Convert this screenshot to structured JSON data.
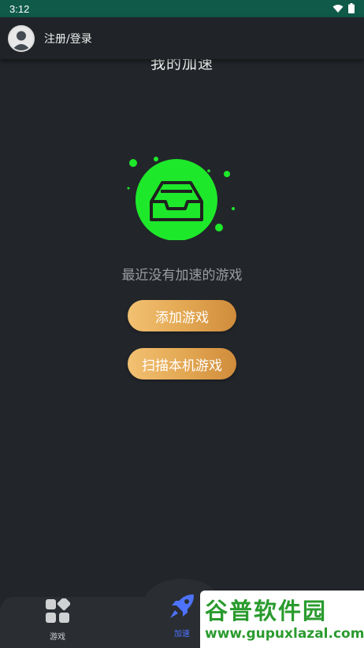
{
  "status_bar": {
    "time": "3:12",
    "icons": [
      "wifi-icon",
      "battery-icon"
    ]
  },
  "header": {
    "login_label": "注册/登录",
    "avatar_icon": "user-avatar-icon"
  },
  "page": {
    "title": "我的加速"
  },
  "empty_state": {
    "message": "最近没有加速的游戏",
    "illustration_icon": "inbox-tray-icon",
    "accent_color": "#1ee82a"
  },
  "actions": {
    "add_game_label": "添加游戏",
    "scan_games_label": "扫描本机游戏"
  },
  "bottom_nav": {
    "items": [
      {
        "label": "游戏",
        "icon": "grid-apps-icon",
        "active": false
      },
      {
        "label": "加速",
        "icon": "rocket-icon",
        "active": true
      }
    ],
    "active_color": "#4e73ff"
  },
  "watermark": {
    "title": "谷普软件园",
    "url": "www.gupuxlazal.com"
  },
  "colors": {
    "background": "#22262a",
    "status_bar": "#0f5a49",
    "button_gradient_start": "#f2c172",
    "button_gradient_end": "#cf8c3c"
  }
}
